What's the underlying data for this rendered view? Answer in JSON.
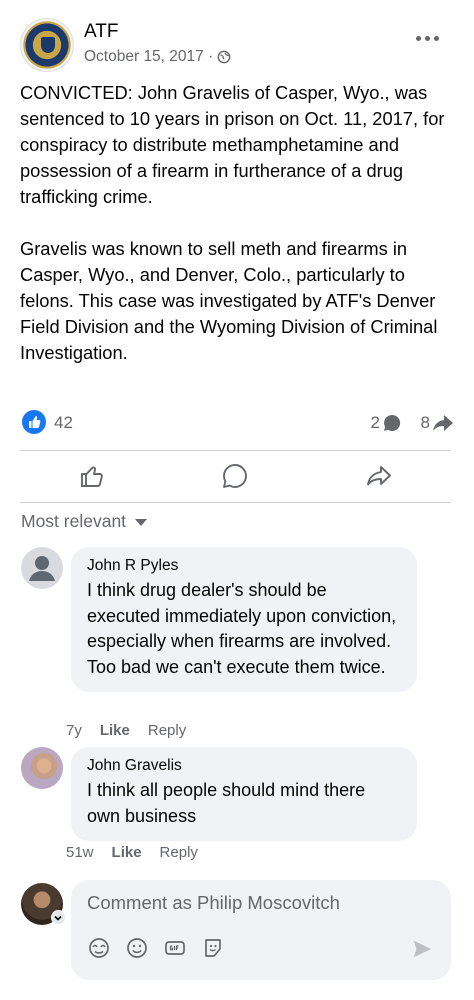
{
  "post": {
    "page_name": "ATF",
    "date": "October 15, 2017 ·",
    "paragraphs": [
      "CONVICTED: John Gravelis of Casper, Wyo., was sentenced to 10 years in prison on Oct. 11, 2017, for conspiracy to distribute methamphetamine and possession of a firearm in furtherance of a drug trafficking crime.",
      "Gravelis was known to sell meth and firearms in Casper, Wyo., and Denver, Colo., particularly to felons. This case was investigated by ATF's Denver Field Division and the Wyoming Division of Criminal Investigation."
    ]
  },
  "stats": {
    "likes": "42",
    "comments": "2",
    "shares": "8"
  },
  "sort": {
    "label": "Most relevant"
  },
  "comments": [
    {
      "author": "John R Pyles",
      "text": "I think drug dealer's should be executed immediately upon conviction, especially when firearms are involved. Too bad we can't execute them twice.",
      "time": "7y",
      "like_label": "Like",
      "reply_label": "Reply"
    },
    {
      "author": "John Gravelis",
      "text": "I think all people should mind there own business",
      "time": "51w",
      "like_label": "Like",
      "reply_label": "Reply"
    }
  ],
  "composer": {
    "placeholder": "Comment as Philip Moscovitch"
  },
  "icons": {
    "more": "more-horizontal-icon",
    "globe": "globe-icon",
    "like": "thumbs-up-icon",
    "comment": "comment-bubble-icon",
    "share": "share-arrow-icon",
    "caret": "caret-down-icon",
    "send": "send-icon"
  },
  "colors": {
    "accent": "#1877f2",
    "secondary_text": "#65676b",
    "bubble": "#f0f2f5",
    "divider": "#ced0d4"
  }
}
